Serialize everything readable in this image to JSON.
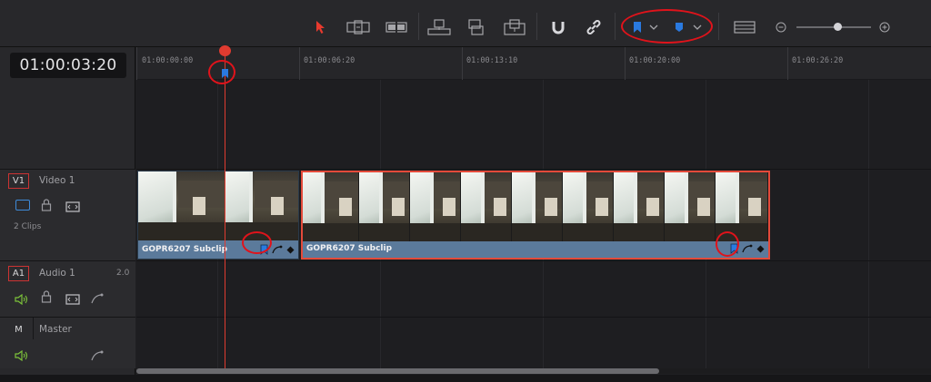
{
  "toolbar": {
    "icons": [
      "selection-arrow",
      "trim-edit",
      "blade-edit",
      "insert-clip",
      "overwrite-clip",
      "replace-clip",
      "snapping",
      "linked-selection",
      "flag",
      "marker",
      "timeline-view-options",
      "zoom-out",
      "zoom-slider",
      "zoom-in"
    ],
    "accent_color": "#e83a2e",
    "flag_color": "#2a7ae0",
    "zoom_level": 0.55
  },
  "timecode": "01:00:03:20",
  "ruler": {
    "ticks": [
      "01:00:00:00",
      "01:00:06:20",
      "01:00:13:10",
      "01:00:20:00",
      "01:00:26:20"
    ]
  },
  "tracks": {
    "video": {
      "id": "V1",
      "name": "Video 1",
      "clip_count": "2 Clips"
    },
    "audio": {
      "id": "A1",
      "name": "Audio 1",
      "level": "2.0"
    },
    "master": {
      "id": "M",
      "name": "Master"
    }
  },
  "clips": [
    {
      "title": "GOPR6207 Subclip",
      "selected": false
    },
    {
      "title": "GOPR6207 Subclip",
      "selected": true
    }
  ],
  "colors": {
    "clip_fill": "#5b7a9b",
    "selection": "#e44a3a",
    "playhead": "#e03b30",
    "annotation": "#e0131b",
    "marker": "#2a7ae0"
  }
}
